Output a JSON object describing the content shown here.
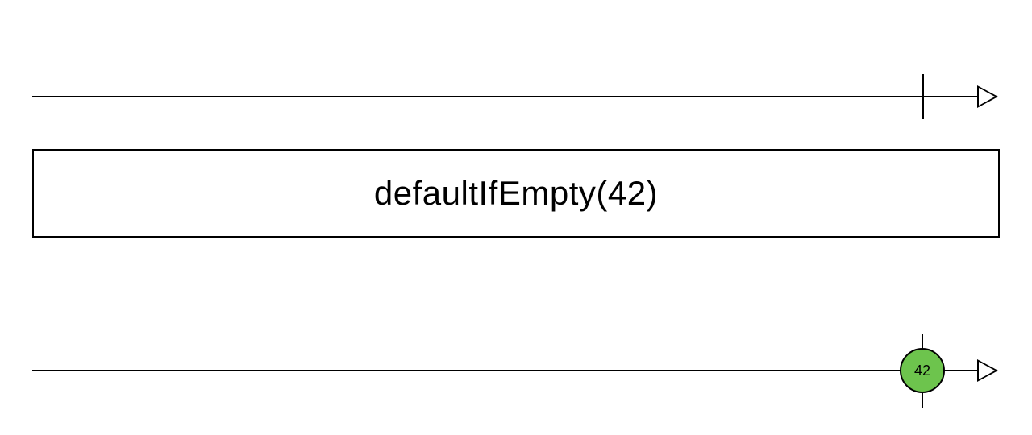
{
  "diagram": {
    "operator_label": "defaultIfEmpty(42)",
    "input_timeline": {
      "events": [],
      "completion_position_percent": 92
    },
    "output_timeline": {
      "events": [
        {
          "value": "42",
          "position_percent": 92,
          "color": "#6dc44d"
        }
      ]
    },
    "colors": {
      "line": "#000000",
      "background": "#ffffff",
      "marble_fill": "#6dc44d"
    }
  }
}
